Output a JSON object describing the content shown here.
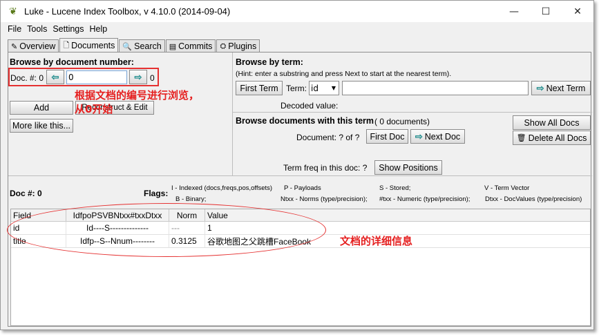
{
  "window": {
    "title": "Luke - Lucene Index Toolbox, v 4.10.0 (2014-09-04)",
    "controls": {
      "minimize": "—",
      "maximize": "☐",
      "close": "✕"
    }
  },
  "menu": {
    "file": "File",
    "tools": "Tools",
    "settings": "Settings",
    "help": "Help"
  },
  "tabs": [
    {
      "label": "Overview",
      "icon": "✎"
    },
    {
      "label": "Documents",
      "icon": "🗋",
      "active": true
    },
    {
      "label": "Search",
      "icon": "🔍"
    },
    {
      "label": "Commits",
      "icon": "▤"
    },
    {
      "label": "Plugins",
      "icon": "⛭"
    }
  ],
  "left_panel": {
    "heading": "Browse by document number:",
    "doc_label": "Doc. #: 0",
    "doc_value": "0",
    "doc_max": "0",
    "add_button": "Add",
    "reconstruct_button": "Reconstruct & Edit",
    "more_like_button": "More like this...",
    "annotation": "根据文档的编号进行浏览，从0开始"
  },
  "right_panel": {
    "heading": "Browse by term:",
    "hint": "(Hint: enter a substring and press Next to start at the nearest term).",
    "first_term_button": "First Term",
    "term_label": "Term:",
    "term_select": "id",
    "term_value": "",
    "next_term_button": "Next Term",
    "decoded_label": "Decoded value:",
    "docs_heading": "Browse documents with this term",
    "docs_count": "( 0  documents)",
    "document_label": "Document: ?  of  ?",
    "first_doc_button": "First Doc",
    "next_doc_button": "Next Doc",
    "show_all_button": "Show All Docs",
    "delete_all_button": "Delete All Docs",
    "term_freq_label": "Term freq in this doc: ?",
    "show_positions_button": "Show Positions"
  },
  "doc_info": {
    "doc_num": "Doc #: 0",
    "flags_label": "Flags:",
    "flags": [
      "I - Indexed (docs,freqs,pos,offsets)",
      "P - Payloads",
      "S - Stored;",
      "V - Term Vector",
      "B - Binary;",
      "Ntxx - Norms (type/precision);",
      "#txx - Numeric (type/precision);",
      "Dtxx - DocValues (type/precision)"
    ]
  },
  "table": {
    "columns": [
      "Field",
      "IdfpoPSVBNtxx#txxDtxx",
      "Norm",
      "Value"
    ],
    "rows": [
      {
        "field": "id",
        "flags": "Id----S--------------",
        "norm": "---",
        "value": "1"
      },
      {
        "field": "title",
        "flags": "Idfp--S--Nnum--------",
        "norm": "0.3125",
        "value": "谷歌地图之父跳槽FaceBook"
      }
    ],
    "annotation": "文档的详细信息"
  }
}
